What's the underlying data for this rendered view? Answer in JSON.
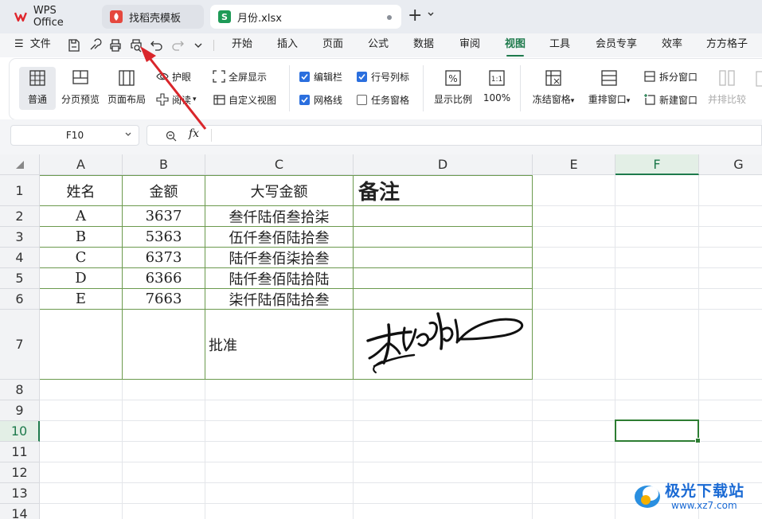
{
  "tabs": {
    "wps": "WPS Office",
    "daoke": "找稻壳模板",
    "file": "月份.xlsx",
    "file_icon_letter": "S"
  },
  "menu": {
    "file": "文件",
    "items": [
      "开始",
      "插入",
      "页面",
      "公式",
      "数据",
      "审阅",
      "视图",
      "工具",
      "会员专享",
      "效率",
      "方方格子"
    ],
    "active": "视图"
  },
  "ribbon": {
    "normal": "普通",
    "page_break": "分页预览",
    "page_layout": "页面布局",
    "eye_care": "护眼",
    "reading": "阅读",
    "fullscreen": "全屏显示",
    "custom_view": "自定义视图",
    "edit_bar": "编辑栏",
    "row_col_header": "行号列标",
    "gridlines": "网格线",
    "task_pane": "任务窗格",
    "zoom": "显示比例",
    "zoom100": "100%",
    "zoom100_icon": "1:1",
    "freeze": "冻结窗格",
    "rearrange": "重排窗口",
    "split": "拆分窗口",
    "new_window": "新建窗口",
    "side_by_side": "并排比较"
  },
  "formula_bar": {
    "name_box": "F10",
    "fx": "fx",
    "value": ""
  },
  "columns": [
    "A",
    "B",
    "C",
    "D",
    "E",
    "F",
    "G"
  ],
  "selected_column": "F",
  "rows": [
    "1",
    "2",
    "3",
    "4",
    "5",
    "6",
    "7",
    "8",
    "9",
    "10",
    "11",
    "12",
    "13",
    "14"
  ],
  "selected_row": "10",
  "table": {
    "header": [
      "姓名",
      "金额",
      "大写金额",
      "备注"
    ],
    "data": [
      [
        "A",
        "3637",
        "叁仟陆佰叁拾柒"
      ],
      [
        "B",
        "5363",
        "伍仟叁佰陆拾叁"
      ],
      [
        "C",
        "6373",
        "陆仟叁佰柒拾叁"
      ],
      [
        "D",
        "6366",
        "陆仟叁佰陆拾陆"
      ],
      [
        "E",
        "7663",
        "柒仟陆佰陆拾叁"
      ]
    ],
    "approval": "批准"
  },
  "watermark": {
    "text": "极光下载站",
    "url": "www.xz7.com"
  },
  "colors": {
    "accent": "#1e7a4c",
    "table_border": "#6b9a4e",
    "arrow": "#d9262b"
  }
}
